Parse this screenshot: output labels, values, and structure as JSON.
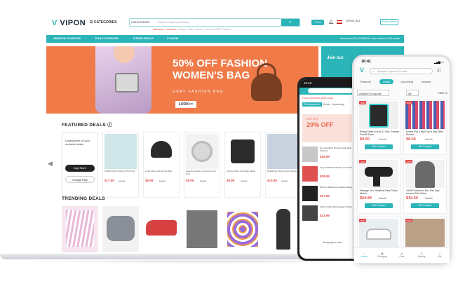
{
  "laptop": {
    "logo_mark": "V",
    "logo_text": "VIPON",
    "categories_label": "CATEGORIES",
    "search": {
      "category": "CATEGORIES",
      "placeholder": "Search Coupons & Deals",
      "button": "⌕"
    },
    "hot_prefix": "",
    "hot_items": [
      "halloween",
      "costumes",
      "vintage",
      "Glitter",
      "jewelry",
      "i crochet 2024",
      "Playdoh"
    ],
    "post_label": "+ Post",
    "user": "VIPON_821",
    "seller_label": "Seller Center",
    "nav": [
      "AMAZON COUPONS",
      "DAILY COUPONS",
      "OTHER DEALS",
      "V-SHOW"
    ],
    "ticker": "akuabrun1 ZX_0435EK41 has received 500 points",
    "hero": {
      "title_line1": "50% OFF FASHION",
      "title_line2": "WOMEN'S BAG",
      "subtitle": "GRAY FASHION BAG",
      "button": "LOOK>>"
    },
    "side_ad": {
      "text": "Join our"
    },
    "featured_title": "FEATURED DEALS",
    "app_card": {
      "text": "Lowest price on your exclusive deals",
      "app_store": "App Store",
      "google_play": "Google Play"
    },
    "deals": [
      {
        "name": "CAME Kitchen Rugs 2 PCS Cus",
        "price": "$17.99",
        "old": "$34.99",
        "color": "#cfe5e8"
      },
      {
        "name": "Livelz Mens Helmet For Bike",
        "price": "$9.99",
        "old": "$19.99",
        "color": "#2a2a2a"
      },
      {
        "name": "Fanelira Flexible 4 Aluminum Air Duct",
        "price": "$9.99",
        "old": "$19.99",
        "color": "#d8d8d8"
      },
      {
        "name": "Upsizsu Body Fat Scale Digital",
        "price": "$9.99",
        "old": "$19.99",
        "color": "#2b2b2b"
      },
      {
        "name": "Digital Day Clock Large Display",
        "price": "$13.99",
        "old": "$26.99",
        "color": "#c9d3e0"
      }
    ],
    "trending_title": "TRENDING DEALS",
    "trending_colors": [
      "#e8b7d9",
      "#8a8f98",
      "#d64040",
      "#777",
      "#9b6cd6",
      "#333"
    ]
  },
  "phone1": {
    "time": "16:43",
    "ticker": "Found exclusive deals today",
    "tabs": [
      "Recommend",
      "Deals",
      "Upcoming"
    ],
    "banner_small": "20% OFF",
    "banner_big": "20% OFF",
    "rows": [
      {
        "name": "Ivey Handheld Shower Head High Pressure",
        "price": "$25.99"
      },
      {
        "name": "Joey Handheld Steamer for Clothes",
        "price": "$29.99"
      },
      {
        "name": "Women Waterproof Jackets Hiking",
        "price": "$17.99"
      },
      {
        "name": "Stiefel Trolley Mini Speaker Wireless",
        "price": "$12.99"
      }
    ],
    "url": "myvipon.com"
  },
  "phone2": {
    "time": "16:41",
    "logo": "V",
    "search_placeholder": "Search Coupons & Deals",
    "tabs": [
      "Featured",
      "Deals",
      "Upcoming",
      "Newest"
    ],
    "select1": "Amazon Coupons",
    "select2": "All",
    "filter": "Filter",
    "cards": [
      {
        "disc": "-50%",
        "name": "Writing Tablet for Kids 12 Inch, Portable Doodle Board",
        "price": "$9.00",
        "old": "$17.99",
        "btn": "Get Coupon",
        "color": "#2a2a2a"
      },
      {
        "disc": "-50%",
        "name": "Dinette Plus 6 Pack Set of Jelly Table Runners",
        "price": "$6.00",
        "old": "$12.00",
        "btn": "Get Coupon",
        "color": "#4a5fb0"
      },
      {
        "disc": "-40%",
        "name": "Massage Gun, Handheld Deep Tissue Muscle",
        "price": "$24.99",
        "old": "$41.99",
        "btn": "Get Coupon",
        "color": "#222"
      },
      {
        "disc": "-50%",
        "name": "YAKINO Women's Plus Size Tops Leopard Print Cotton",
        "price": "$10.50",
        "old": "$20.99",
        "btn": "Get Coupon",
        "color": "#6a6a6a"
      },
      {
        "disc": "-50%",
        "name": "",
        "price": "",
        "old": "",
        "btn": "",
        "color": "#e9eef0"
      },
      {
        "disc": "-50%",
        "name": "",
        "price": "",
        "old": "",
        "btn": "",
        "color": "#b9a087"
      }
    ],
    "footer": [
      "Home",
      "Category",
      "Post",
      "Activity",
      "Me"
    ]
  }
}
